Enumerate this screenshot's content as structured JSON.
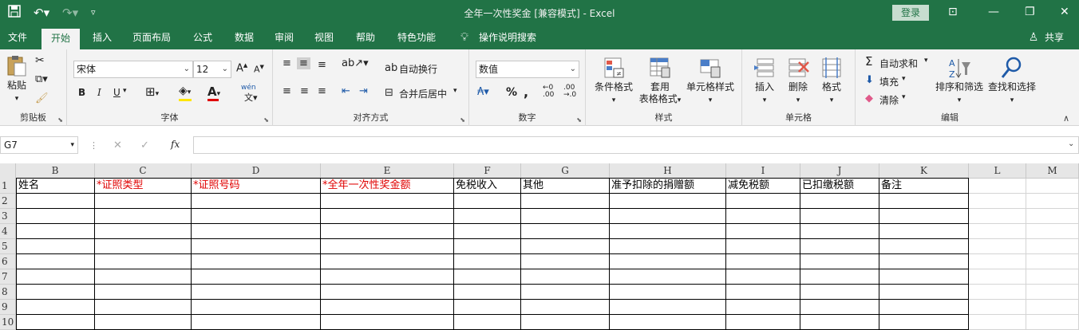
{
  "titlebar": {
    "title": "全年一次性奖金  [兼容模式]  -  Excel",
    "login": "登录",
    "save_icon": "save-icon",
    "undo_icon": "undo-icon",
    "redo_icon": "redo-icon"
  },
  "tabs": [
    "文件",
    "开始",
    "插入",
    "页面布局",
    "公式",
    "数据",
    "审阅",
    "视图",
    "帮助",
    "特色功能"
  ],
  "tell_me": "操作说明搜索",
  "share": "共享",
  "ribbon": {
    "clipboard": {
      "paste": "粘贴",
      "label": "剪贴板"
    },
    "font": {
      "name": "宋体",
      "size": "12",
      "label": "字体",
      "bold": "B",
      "italic": "I",
      "underline": "U",
      "phonetic": "wén",
      "font_color": "#e00000",
      "fill_color": "#ffe600"
    },
    "align": {
      "wrap": "自动换行",
      "merge": "合并后居中",
      "label": "对齐方式"
    },
    "number": {
      "format": "数值",
      "percent": "%",
      "comma": ",",
      "label": "数字"
    },
    "styles": {
      "cond": "条件格式",
      "table1": "套用",
      "table2": "表格格式",
      "cell": "单元格样式",
      "label": "样式"
    },
    "cells": {
      "insert": "插入",
      "delete": "删除",
      "format": "格式",
      "label": "单元格"
    },
    "edit": {
      "autosum": "自动求和",
      "fill": "填充",
      "clear": "清除",
      "sort": "排序和筛选",
      "find": "查找和选择",
      "label": "编辑"
    }
  },
  "formula_bar": {
    "name_box": "G7",
    "fx": "fx",
    "formula": ""
  },
  "sheet": {
    "columns": [
      "B",
      "C",
      "D",
      "E",
      "F",
      "G",
      "H",
      "I",
      "J",
      "K",
      "L",
      "M"
    ],
    "rows": [
      "1",
      "2",
      "3",
      "4",
      "5",
      "6",
      "7",
      "8",
      "9",
      "10"
    ],
    "header_row": [
      "姓名",
      "*证照类型",
      "*证照号码",
      "*全年一次性奖金额",
      "免税收入",
      "其他",
      "准予扣除的捐赠额",
      "减免税额",
      "已扣缴税额",
      "备注"
    ],
    "required_color": "#e00000"
  }
}
